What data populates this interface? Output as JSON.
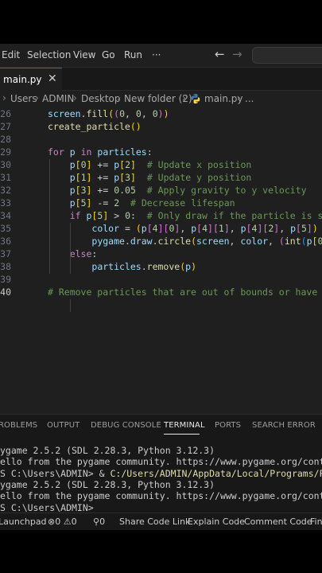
{
  "menu": {
    "items": [
      "Edit",
      "Selection",
      "View",
      "Go",
      "Run",
      "···"
    ],
    "back_icon": "arrow-left",
    "forward_icon": "arrow-right"
  },
  "tab": {
    "label": "main.py",
    "close": "✕"
  },
  "breadcrumb": {
    "items": [
      "Users",
      "ADMIN",
      "Desktop",
      "New folder (2)",
      "main.py",
      "..."
    ],
    "separator": "›"
  },
  "editor": {
    "active_line": 40,
    "colors": {
      "keyword": "#c586c0",
      "function": "#dcdcaa",
      "variable": "#9cdcfe",
      "number": "#b5cea8",
      "comment": "#6a9955",
      "plain": "#cccccc",
      "bracket1": "#ffd700",
      "bracket2": "#da70d6",
      "bracket3": "#179fff"
    },
    "lines": [
      {
        "num": "26",
        "text": "screen.fill((0, 0, 0))"
      },
      {
        "num": "27",
        "text": "create_particle()"
      },
      {
        "num": "28",
        "text": ""
      },
      {
        "num": "29",
        "text": "for p in particles:"
      },
      {
        "num": "30",
        "text": "    p[0] += p[2]  # Update x position"
      },
      {
        "num": "31",
        "text": "    p[1] += p[3]  # Update y position"
      },
      {
        "num": "32",
        "text": "    p[3] += 0.05  # Apply gravity to y velocity"
      },
      {
        "num": "33",
        "text": "    p[5] -= 2  # Decrease lifespan"
      },
      {
        "num": "34",
        "text": "    if p[5] > 0:  # Only draw if the particle is stil"
      },
      {
        "num": "35",
        "text": "        color = (p[4][0], p[4][1], p[4][2], p[5])"
      },
      {
        "num": "36",
        "text": "        pygame.draw.circle(screen, color, (int(p[0]),"
      },
      {
        "num": "37",
        "text": "    else:"
      },
      {
        "num": "38",
        "text": "        particles.remove(p)"
      },
      {
        "num": "39",
        "text": ""
      },
      {
        "num": "40",
        "text": "# Remove particles that are out of bounds or have no"
      }
    ]
  },
  "panel": {
    "tabs": [
      "ROBLEMS",
      "OUTPUT",
      "DEBUG CONSOLE",
      "TERMINAL",
      "PORTS",
      "SEARCH ERROR"
    ],
    "active_tab": "TERMINAL",
    "terminal": [
      {
        "text": "ygame 2.5.2 (SDL 2.28.3, Python 3.12.3)"
      },
      {
        "text": "ello from the pygame community. https://www.pygame.org/contribute.htm"
      },
      {
        "prompt": "S C:\\Users\\ADMIN> & ",
        "cmd": "C:/Users/ADMIN/AppData/Local/Programs/Python/Pyth"
      },
      {
        "text": "ygame 2.5.2 (SDL 2.28.3, Python 3.12.3)"
      },
      {
        "text": "ello from the pygame community. https://www.pygame.org/contribute.htm"
      },
      {
        "text": "S C:\\Users\\ADMIN>"
      }
    ]
  },
  "status": {
    "launchpad": "Launchpad",
    "errors": "0",
    "warnings": "0",
    "ports": "0",
    "share": "Share Code Link",
    "explain": "Explain Code",
    "comment": "Comment Code",
    "find": "Fin"
  }
}
